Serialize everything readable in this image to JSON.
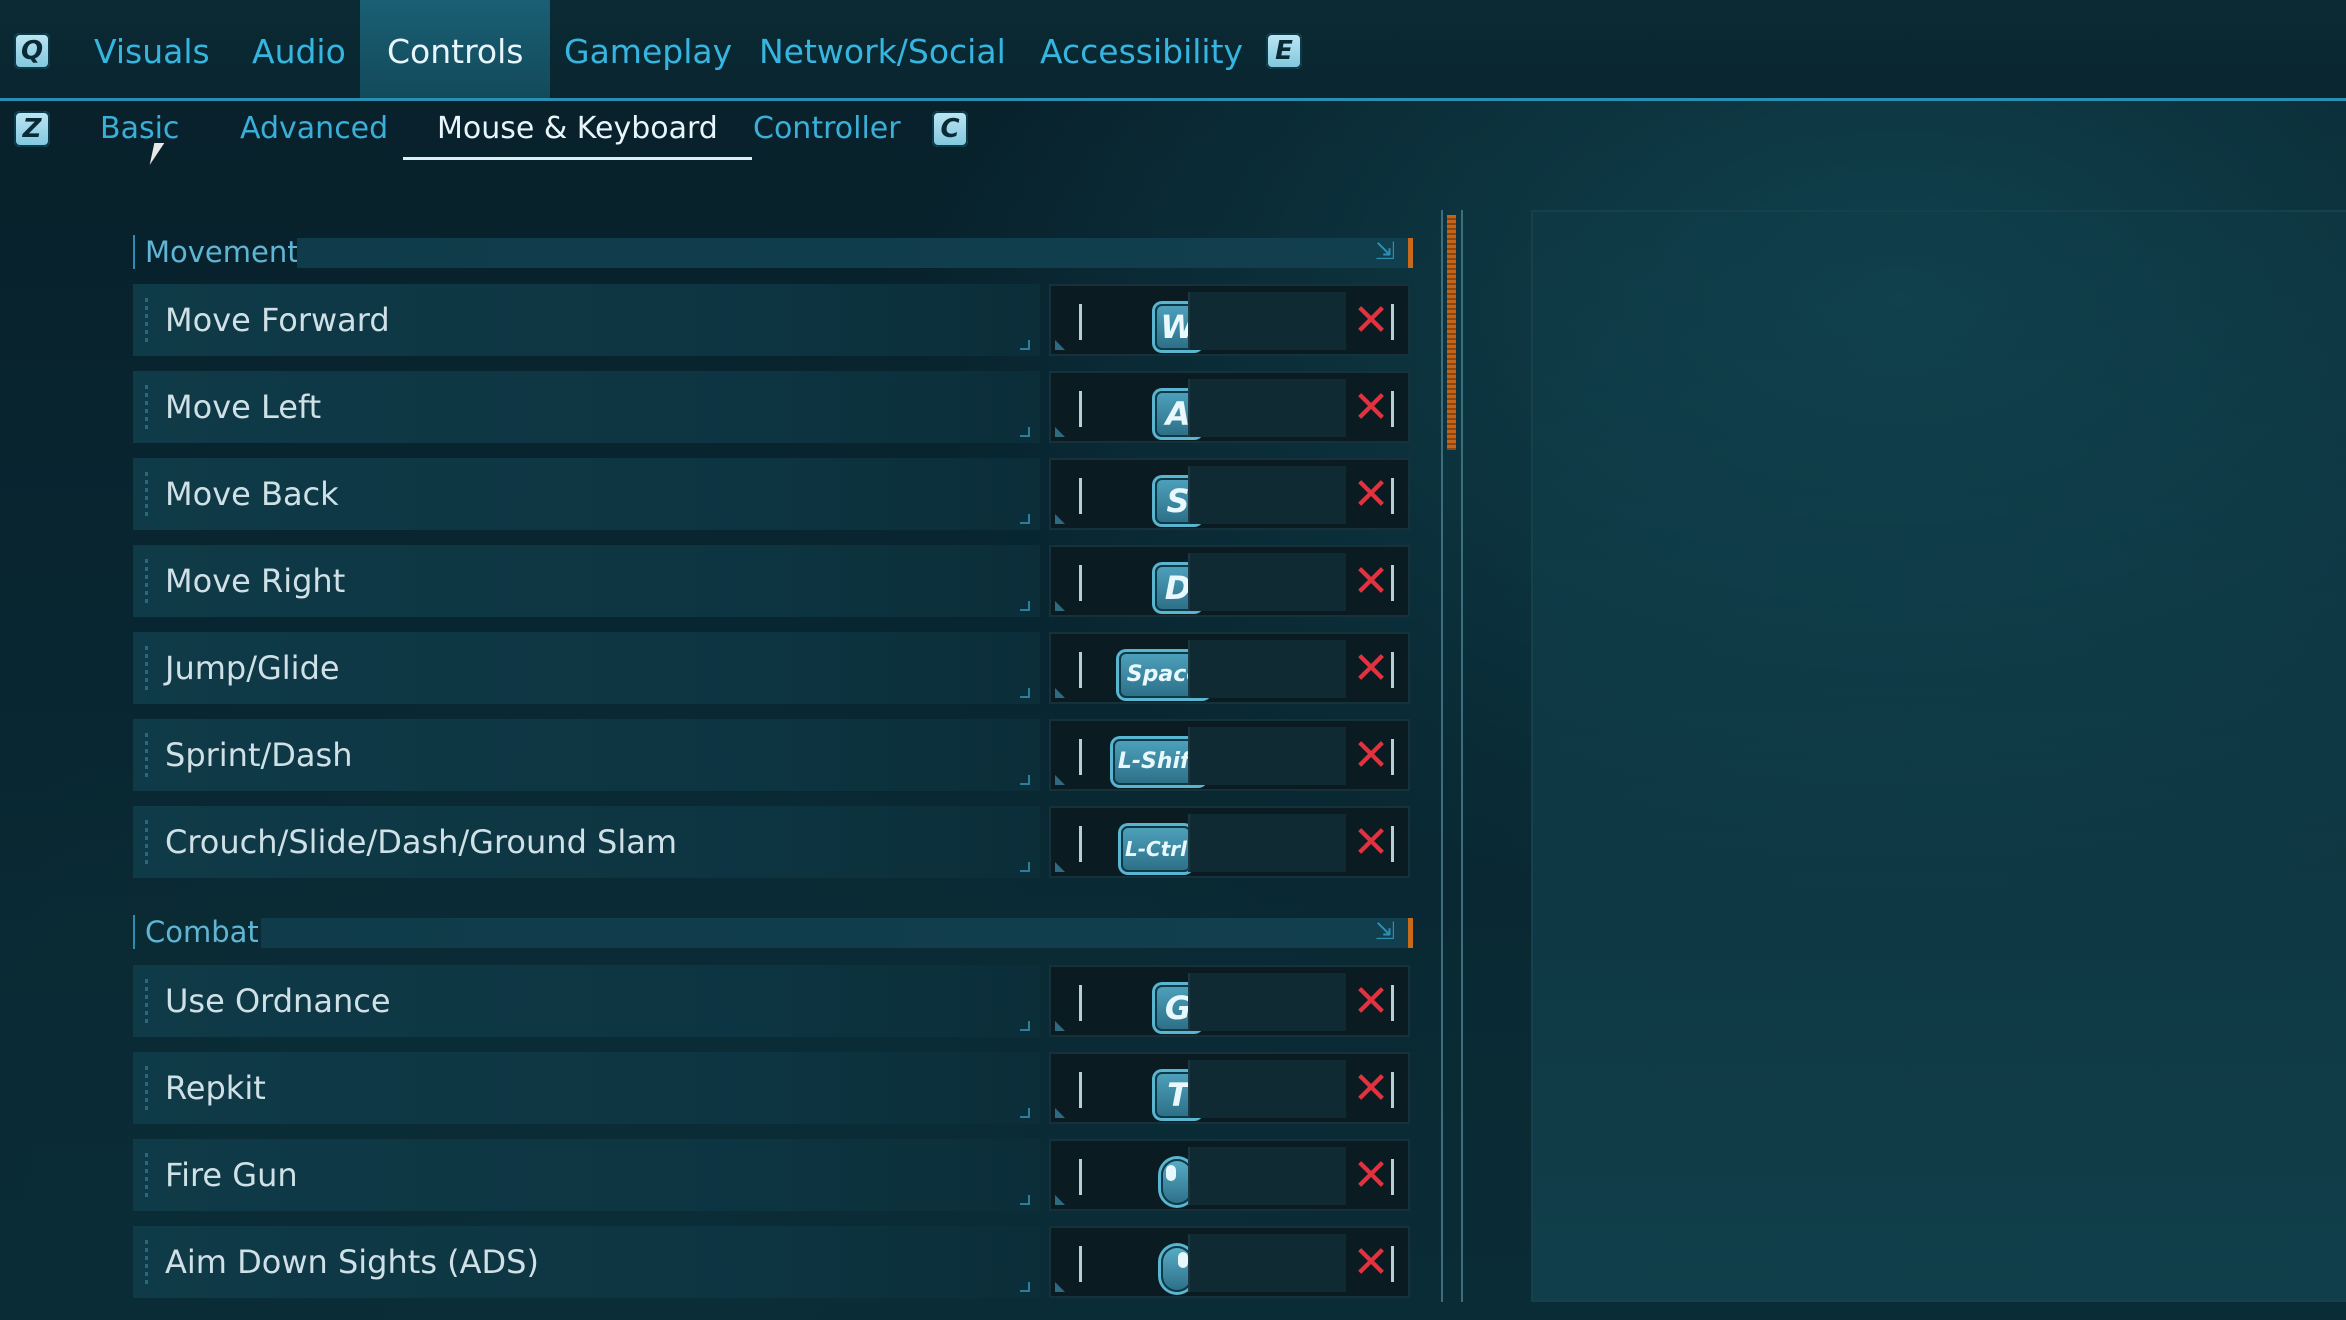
{
  "top_nav": {
    "left_key": "Q",
    "right_key": "E",
    "tabs": [
      {
        "label": "Visuals"
      },
      {
        "label": "Audio"
      },
      {
        "label": "Controls",
        "active": true
      },
      {
        "label": "Gameplay"
      },
      {
        "label": "Network/Social"
      },
      {
        "label": "Accessibility"
      }
    ]
  },
  "sub_nav": {
    "left_key": "Z",
    "right_key": "C",
    "tabs": [
      {
        "label": "Basic"
      },
      {
        "label": "Advanced"
      },
      {
        "label": "Mouse & Keyboard",
        "active": true
      },
      {
        "label": "Controller"
      }
    ]
  },
  "sections": [
    {
      "title": "Movement",
      "bindings": [
        {
          "action": "Move Forward",
          "key": "W"
        },
        {
          "action": "Move Left",
          "key": "A"
        },
        {
          "action": "Move Back",
          "key": "S"
        },
        {
          "action": "Move Right",
          "key": "D"
        },
        {
          "action": "Jump/Glide",
          "key": "Space"
        },
        {
          "action": "Sprint/Dash",
          "key": "L-Shift"
        },
        {
          "action": "Crouch/Slide/Dash/Ground Slam",
          "key": "L-Ctrl"
        }
      ]
    },
    {
      "title": "Combat",
      "bindings": [
        {
          "action": "Use Ordnance",
          "key": "G"
        },
        {
          "action": "Repkit",
          "key": "T"
        },
        {
          "action": "Fire Gun",
          "key": "left-mouse-button-icon"
        },
        {
          "action": "Aim Down Sights (ADS)",
          "key": "right-mouse-button-icon"
        }
      ]
    }
  ],
  "icons": {
    "clear": "✕",
    "collapse": "⇲"
  },
  "colors": {
    "accent": "#36b5e0",
    "delete": "#e2323f",
    "scroll_thumb": "#c56418"
  }
}
